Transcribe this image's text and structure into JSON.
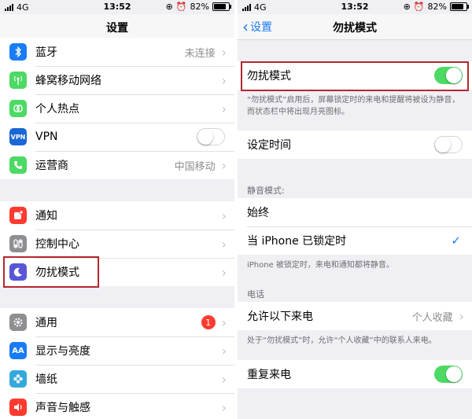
{
  "left": {
    "status": {
      "carrier": "4G",
      "time": "13:52",
      "battery": "82%",
      "battery_level": 0.82
    },
    "nav": {
      "title": "设置"
    },
    "group1": [
      {
        "label": "蓝牙",
        "value": "未连接",
        "icon": "bluetooth-icon",
        "color": "#1a7cf4"
      },
      {
        "label": "蜂窝移动网络",
        "value": "",
        "icon": "cellular-antenna-icon",
        "color": "#4cd964"
      },
      {
        "label": "个人热点",
        "value": "",
        "icon": "hotspot-link-icon",
        "color": "#4cd964"
      },
      {
        "label": "VPN",
        "value": "",
        "icon": "vpn-icon",
        "color": "#1a67d4",
        "toggle": "off"
      },
      {
        "label": "运营商",
        "value": "中国移动",
        "icon": "phone-icon",
        "color": "#4cd964"
      }
    ],
    "group2": [
      {
        "label": "通知",
        "icon": "notifications-icon",
        "color": "#fe3b30"
      },
      {
        "label": "控制中心",
        "icon": "control-center-icon",
        "color": "#8e8e93"
      },
      {
        "label": "勿扰模式",
        "icon": "moon-icon",
        "color": "#5856d6"
      }
    ],
    "group3": [
      {
        "label": "通用",
        "icon": "gear-icon",
        "color": "#8e8e93",
        "badge": "1"
      },
      {
        "label": "显示与亮度",
        "icon": "text-size-icon",
        "color": "#1a7cf4"
      },
      {
        "label": "墙纸",
        "icon": "wallpaper-flower-icon",
        "color": "#34aadc"
      },
      {
        "label": "声音与触感",
        "icon": "speaker-icon",
        "color": "#fe3b30"
      }
    ]
  },
  "right": {
    "status": {
      "carrier": "4G",
      "time": "13:52",
      "battery": "82%",
      "battery_level": 0.82
    },
    "nav": {
      "title": "勿扰模式",
      "back": "设置"
    },
    "dnd_label": "勿扰模式",
    "dnd_toggle": "on",
    "dnd_note": "“勿扰模式”启用后，屏幕锁定时的来电和提醒将被设为静音，而状态栏中将出现月亮图标。",
    "scheduled_label": "设定时间",
    "scheduled_toggle": "off",
    "silence_header": "静音模式:",
    "silence_always": "始终",
    "silence_locked": "当 iPhone 已锁定时",
    "silence_note": "iPhone 被锁定时，来电和通知都将静音。",
    "phone_header": "电话",
    "allow_calls_label": "允许以下来电",
    "allow_calls_value": "个人收藏",
    "allow_calls_note": "处于“勿扰模式”时，允许“个人收藏”中的联系人来电。",
    "repeated_calls_label": "重复来电",
    "repeated_calls_toggle": "on"
  },
  "colors": {
    "accent": "#1a7cf4",
    "toggle_on": "#4cd964",
    "highlight_border": "#b3282d",
    "background": "#efeff4"
  }
}
